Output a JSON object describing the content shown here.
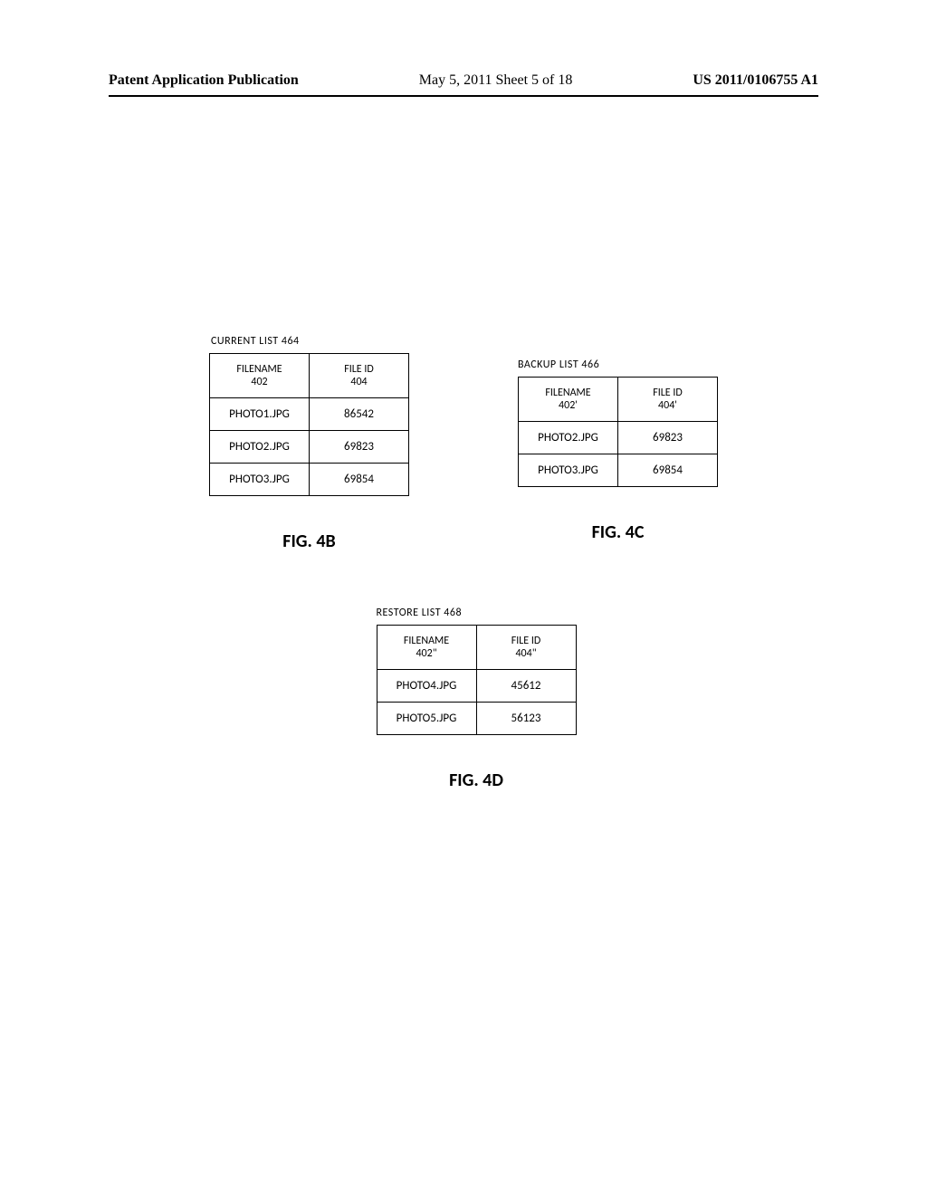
{
  "header": {
    "left": "Patent Application Publication",
    "center": "May 5, 2011  Sheet 5 of 18",
    "right": "US 2011/0106755 A1"
  },
  "figures": {
    "b": {
      "title": "CURRENT LIST 464",
      "col1_label": "FILENAME",
      "col1_ref": "402",
      "col2_label": "FILE ID",
      "col2_ref": "404",
      "rows": [
        {
          "filename": "PHOTO1.JPG",
          "fileid": "86542"
        },
        {
          "filename": "PHOTO2.JPG",
          "fileid": "69823"
        },
        {
          "filename": "PHOTO3.JPG",
          "fileid": "69854"
        }
      ],
      "caption": "FIG. 4B"
    },
    "c": {
      "title": "BACKUP LIST 466",
      "col1_label": "FILENAME",
      "col1_ref": "402'",
      "col2_label": "FILE ID",
      "col2_ref": "404'",
      "rows": [
        {
          "filename": "PHOTO2.JPG",
          "fileid": "69823"
        },
        {
          "filename": "PHOTO3.JPG",
          "fileid": "69854"
        }
      ],
      "caption": "FIG. 4C"
    },
    "d": {
      "title": "RESTORE LIST 468",
      "col1_label": "FILENAME",
      "col1_ref": "402\"",
      "col2_label": "FILE ID",
      "col2_ref": "404\"",
      "rows": [
        {
          "filename": "PHOTO4.JPG",
          "fileid": "45612"
        },
        {
          "filename": "PHOTO5.JPG",
          "fileid": "56123"
        }
      ],
      "caption": "FIG. 4D"
    }
  }
}
